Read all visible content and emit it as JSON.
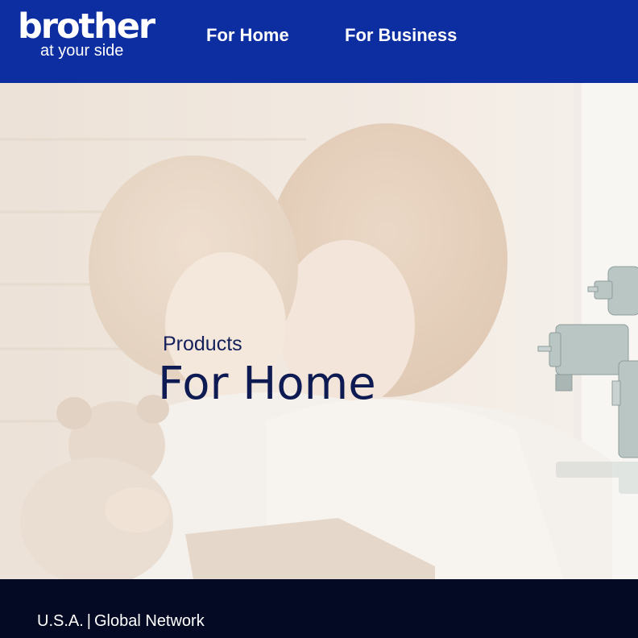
{
  "header": {
    "logo": {
      "brand": "brother",
      "tagline": "at your side"
    },
    "nav": [
      {
        "label": "For Home"
      },
      {
        "label": "For Business"
      }
    ]
  },
  "hero": {
    "eyebrow": "Products",
    "title": "For Home",
    "image_description_icon": "family-photo"
  },
  "footer": {
    "country_link": "U.S.A.",
    "separator": "|",
    "global_link": "Global Network"
  },
  "colors": {
    "header_bg": "#0d2ea0",
    "footer_bg": "#040a23",
    "hero_text": "#0e1a52",
    "hero_bg": "#efe6dc"
  }
}
